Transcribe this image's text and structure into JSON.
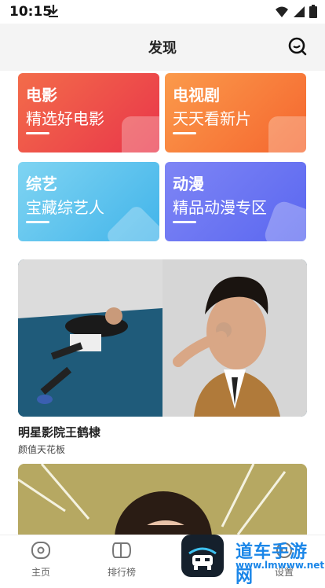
{
  "status_bar": {
    "time": "10:15",
    "icons": [
      "download-icon",
      "wifi-icon",
      "signal-icon",
      "battery-icon"
    ]
  },
  "header": {
    "title": "发现",
    "search_icon": "search-icon"
  },
  "categories": [
    {
      "title": "电影",
      "subtitle": "精选好电影",
      "color_start": "#f36c4a",
      "color_end": "#e9364a"
    },
    {
      "title": "电视剧",
      "subtitle": "天天看新片",
      "color_start": "#fb9a4b",
      "color_end": "#f5662f"
    },
    {
      "title": "综艺",
      "subtitle": "宝藏综艺人",
      "color_start": "#7fd4f2",
      "color_end": "#42b4ea"
    },
    {
      "title": "动漫",
      "subtitle": "精品动漫专区",
      "color_start": "#7e85f5",
      "color_end": "#5a67f0"
    }
  ],
  "features": [
    {
      "title": "明星影院王鹤棣",
      "subtitle": "颜值天花板"
    }
  ],
  "bottom_nav": {
    "items": [
      {
        "label": "主页",
        "icon": "home-eye-icon"
      },
      {
        "label": "排行榜",
        "icon": "rank-icon"
      },
      {
        "label": "设置",
        "icon": "settings-icon"
      }
    ]
  },
  "watermark": {
    "text": "道车手游网",
    "url": "www.lmwww.net"
  }
}
